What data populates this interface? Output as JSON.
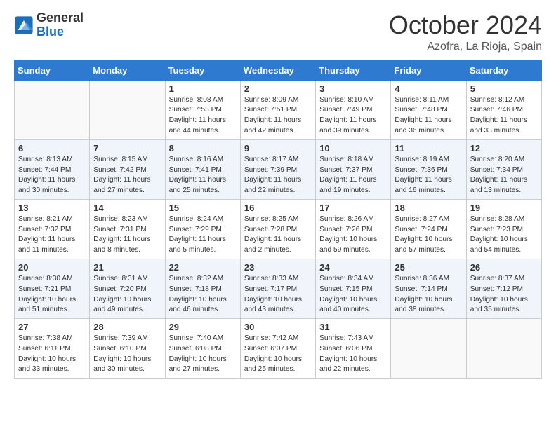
{
  "header": {
    "logo_general": "General",
    "logo_blue": "Blue",
    "month_title": "October 2024",
    "location": "Azofra, La Rioja, Spain"
  },
  "days_of_week": [
    "Sunday",
    "Monday",
    "Tuesday",
    "Wednesday",
    "Thursday",
    "Friday",
    "Saturday"
  ],
  "weeks": [
    [
      {
        "day": "",
        "info": ""
      },
      {
        "day": "",
        "info": ""
      },
      {
        "day": "1",
        "info": "Sunrise: 8:08 AM\nSunset: 7:53 PM\nDaylight: 11 hours and 44 minutes."
      },
      {
        "day": "2",
        "info": "Sunrise: 8:09 AM\nSunset: 7:51 PM\nDaylight: 11 hours and 42 minutes."
      },
      {
        "day": "3",
        "info": "Sunrise: 8:10 AM\nSunset: 7:49 PM\nDaylight: 11 hours and 39 minutes."
      },
      {
        "day": "4",
        "info": "Sunrise: 8:11 AM\nSunset: 7:48 PM\nDaylight: 11 hours and 36 minutes."
      },
      {
        "day": "5",
        "info": "Sunrise: 8:12 AM\nSunset: 7:46 PM\nDaylight: 11 hours and 33 minutes."
      }
    ],
    [
      {
        "day": "6",
        "info": "Sunrise: 8:13 AM\nSunset: 7:44 PM\nDaylight: 11 hours and 30 minutes."
      },
      {
        "day": "7",
        "info": "Sunrise: 8:15 AM\nSunset: 7:42 PM\nDaylight: 11 hours and 27 minutes."
      },
      {
        "day": "8",
        "info": "Sunrise: 8:16 AM\nSunset: 7:41 PM\nDaylight: 11 hours and 25 minutes."
      },
      {
        "day": "9",
        "info": "Sunrise: 8:17 AM\nSunset: 7:39 PM\nDaylight: 11 hours and 22 minutes."
      },
      {
        "day": "10",
        "info": "Sunrise: 8:18 AM\nSunset: 7:37 PM\nDaylight: 11 hours and 19 minutes."
      },
      {
        "day": "11",
        "info": "Sunrise: 8:19 AM\nSunset: 7:36 PM\nDaylight: 11 hours and 16 minutes."
      },
      {
        "day": "12",
        "info": "Sunrise: 8:20 AM\nSunset: 7:34 PM\nDaylight: 11 hours and 13 minutes."
      }
    ],
    [
      {
        "day": "13",
        "info": "Sunrise: 8:21 AM\nSunset: 7:32 PM\nDaylight: 11 hours and 11 minutes."
      },
      {
        "day": "14",
        "info": "Sunrise: 8:23 AM\nSunset: 7:31 PM\nDaylight: 11 hours and 8 minutes."
      },
      {
        "day": "15",
        "info": "Sunrise: 8:24 AM\nSunset: 7:29 PM\nDaylight: 11 hours and 5 minutes."
      },
      {
        "day": "16",
        "info": "Sunrise: 8:25 AM\nSunset: 7:28 PM\nDaylight: 11 hours and 2 minutes."
      },
      {
        "day": "17",
        "info": "Sunrise: 8:26 AM\nSunset: 7:26 PM\nDaylight: 10 hours and 59 minutes."
      },
      {
        "day": "18",
        "info": "Sunrise: 8:27 AM\nSunset: 7:24 PM\nDaylight: 10 hours and 57 minutes."
      },
      {
        "day": "19",
        "info": "Sunrise: 8:28 AM\nSunset: 7:23 PM\nDaylight: 10 hours and 54 minutes."
      }
    ],
    [
      {
        "day": "20",
        "info": "Sunrise: 8:30 AM\nSunset: 7:21 PM\nDaylight: 10 hours and 51 minutes."
      },
      {
        "day": "21",
        "info": "Sunrise: 8:31 AM\nSunset: 7:20 PM\nDaylight: 10 hours and 49 minutes."
      },
      {
        "day": "22",
        "info": "Sunrise: 8:32 AM\nSunset: 7:18 PM\nDaylight: 10 hours and 46 minutes."
      },
      {
        "day": "23",
        "info": "Sunrise: 8:33 AM\nSunset: 7:17 PM\nDaylight: 10 hours and 43 minutes."
      },
      {
        "day": "24",
        "info": "Sunrise: 8:34 AM\nSunset: 7:15 PM\nDaylight: 10 hours and 40 minutes."
      },
      {
        "day": "25",
        "info": "Sunrise: 8:36 AM\nSunset: 7:14 PM\nDaylight: 10 hours and 38 minutes."
      },
      {
        "day": "26",
        "info": "Sunrise: 8:37 AM\nSunset: 7:12 PM\nDaylight: 10 hours and 35 minutes."
      }
    ],
    [
      {
        "day": "27",
        "info": "Sunrise: 7:38 AM\nSunset: 6:11 PM\nDaylight: 10 hours and 33 minutes."
      },
      {
        "day": "28",
        "info": "Sunrise: 7:39 AM\nSunset: 6:10 PM\nDaylight: 10 hours and 30 minutes."
      },
      {
        "day": "29",
        "info": "Sunrise: 7:40 AM\nSunset: 6:08 PM\nDaylight: 10 hours and 27 minutes."
      },
      {
        "day": "30",
        "info": "Sunrise: 7:42 AM\nSunset: 6:07 PM\nDaylight: 10 hours and 25 minutes."
      },
      {
        "day": "31",
        "info": "Sunrise: 7:43 AM\nSunset: 6:06 PM\nDaylight: 10 hours and 22 minutes."
      },
      {
        "day": "",
        "info": ""
      },
      {
        "day": "",
        "info": ""
      }
    ]
  ]
}
